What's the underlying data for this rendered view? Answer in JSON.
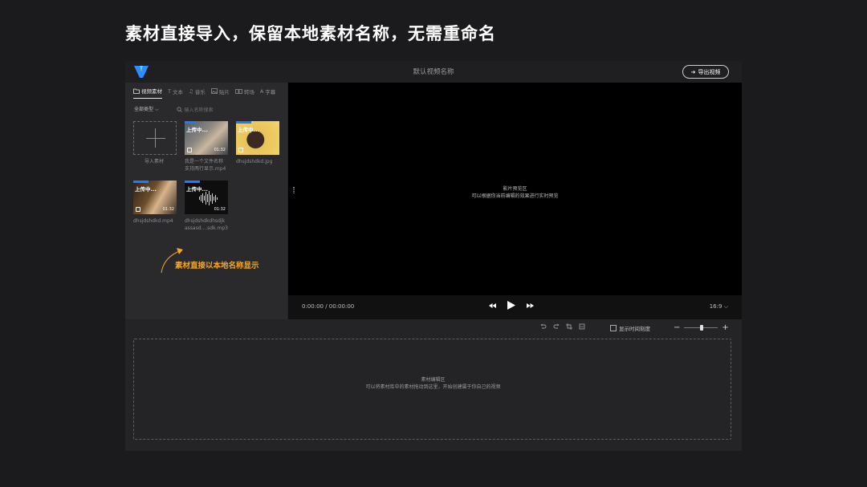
{
  "slide": {
    "title": "素材直接导入，保留本地素材名称，无需重命名"
  },
  "topbar": {
    "project_name": "默认视频名称",
    "export_label": "导出视频"
  },
  "tabs": [
    {
      "label": "视频素材",
      "icon": "folder-icon",
      "active": true
    },
    {
      "label": "文本",
      "icon": "text-icon",
      "active": false
    },
    {
      "label": "音乐",
      "icon": "music-icon",
      "active": false
    },
    {
      "label": "贴片",
      "icon": "image-icon",
      "active": false
    },
    {
      "label": "转场",
      "icon": "transition-icon",
      "active": false
    },
    {
      "label": "字幕",
      "icon": "subtitle-icon",
      "active": false
    }
  ],
  "filter": {
    "type_label": "全部类型",
    "search_placeholder": "输入名称搜索"
  },
  "import": {
    "label": "导入素材"
  },
  "assets": [
    {
      "name_line1": "我是一个文件名称",
      "name_line2": "支持两行显示.mp4",
      "status": "上传中...",
      "progress": 0.25,
      "duration": "01:32"
    },
    {
      "name_line1": "dhsjdshdkd.jpg",
      "name_line2": "",
      "status": "上传中...",
      "progress": 0.35,
      "duration": ""
    },
    {
      "name_line1": "dhsjdshdkd.mp4",
      "name_line2": "",
      "status": "上传中...",
      "progress": 0.35,
      "duration": "01:32"
    },
    {
      "name_line1": "dhsjdshdkdhsdjk",
      "name_line2": "assasd....sdk.mp3",
      "status": "上传中...",
      "progress": 0.35,
      "duration": "01:32"
    }
  ],
  "annotation": {
    "text": "素材直接以本地名称显示",
    "color": "#f5a623"
  },
  "preview": {
    "title": "影片预览区",
    "subtitle": "可以根据你当前编辑的效果进行实时预览"
  },
  "player": {
    "timecode": "0:00:00 / 00:00:00",
    "ratio": "16:9"
  },
  "timeline": {
    "show_scale_label": "显示时间刻度",
    "zoom_level": 0.5
  },
  "edit_area": {
    "title": "素材编辑区",
    "subtitle": "可以将素材库中的素材拖动到这里，开始创建属于你自己的视频"
  },
  "colors": {
    "accent": "#1e7bff",
    "annotation": "#f5a623",
    "background": "#1b1b1d"
  }
}
